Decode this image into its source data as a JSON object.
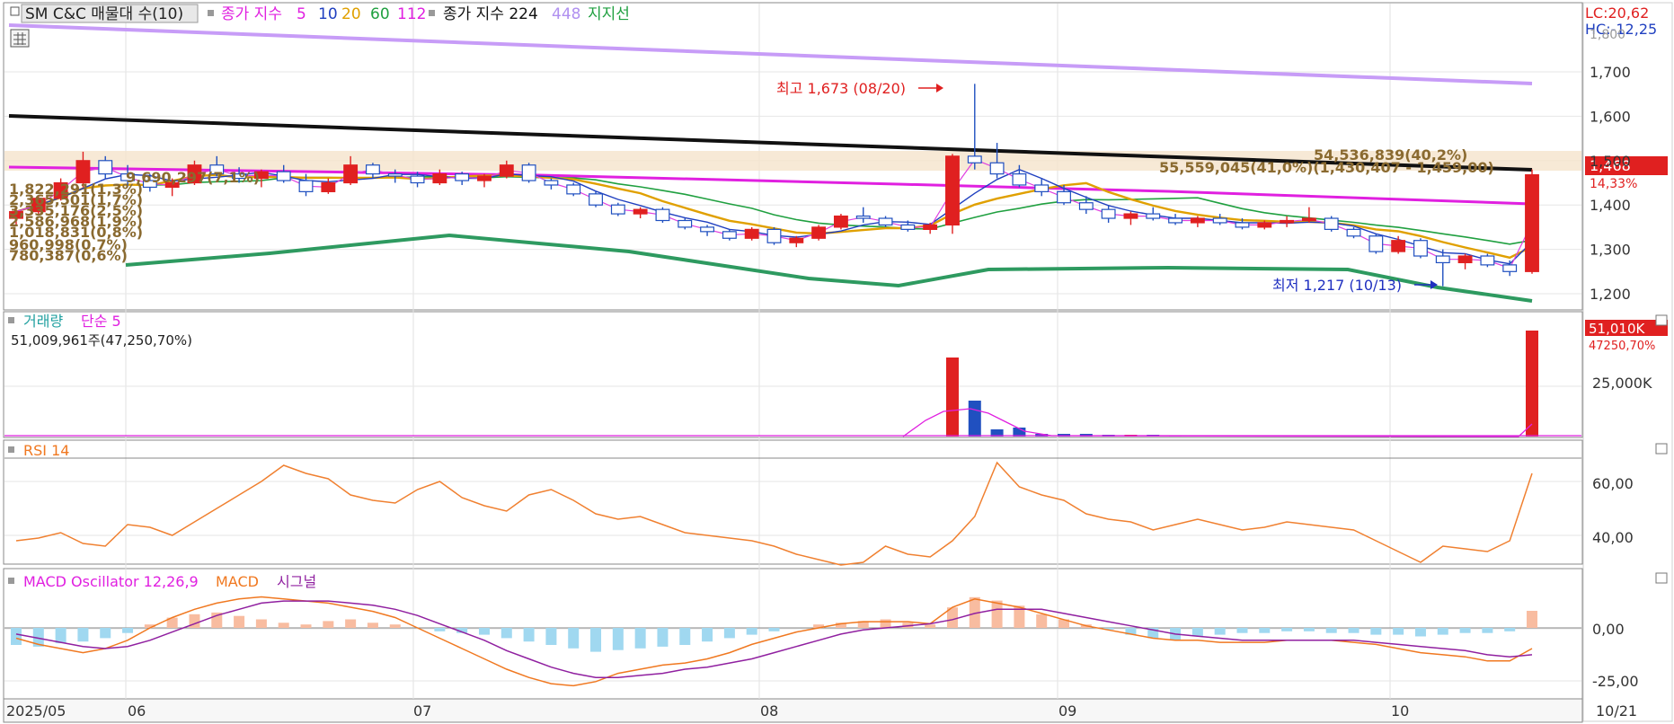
{
  "title": "SM C&C 매물대 수(10)",
  "header": {
    "ma_label": "종가 지수",
    "ma_periods": [
      "5",
      "10",
      "20",
      "60",
      "112"
    ],
    "ma_colors": [
      "#e040e0",
      "#2040c0",
      "#e0a000",
      "#20a040",
      "#e020e0"
    ],
    "ma2_label": "종가 지수 224",
    "ma2_extra": "448",
    "support_label": "지지선"
  },
  "right_info": {
    "lc": "LC:20,62",
    "hc": "HC:-12,25",
    "price": "1,468",
    "change": "14,33%"
  },
  "price_axis": {
    "ticks": [
      "1,700",
      "1,600",
      "1,500",
      "1,400",
      "1,300",
      "1,200"
    ],
    "partial_top": "1,800"
  },
  "annotations": {
    "high": "최고 1,673 (08/20)",
    "low": "최저 1,217 (10/13)"
  },
  "volume_profile": [
    "54,536,839(40,2%)",
    "55,559,045(41,0%)(1,430,407 - 1,459,00)",
    "9,690,297(7,1%)",
    "1,822,291(1,3%)",
    "2,365,501(1,7%)",
    "3,335,176(2,5%)",
    "2,586,968(1,9%)",
    "1,018,831(0,8%)",
    "960,998(0,7%)",
    "780,387(0,6%)"
  ],
  "volume_panel": {
    "title": "거래량",
    "ma_label": "단순 5",
    "info": "51,009,961주(47,250,70%)",
    "right_value": "51,010K",
    "right_sub": "47250,70%",
    "tick": "25,000K"
  },
  "rsi_panel": {
    "title": "RSI 14",
    "ticks": [
      "60,00",
      "40,00"
    ]
  },
  "macd_panel": {
    "title": "MACD Oscillator 12,26,9",
    "macd_label": "MACD",
    "signal_label": "시그널",
    "ticks": [
      "0,00",
      "-25,00"
    ]
  },
  "x_axis": {
    "labels": [
      "2025/05",
      "06",
      "07",
      "08",
      "09",
      "10",
      "10/21"
    ]
  },
  "chart_data": {
    "type": "candlestick",
    "title": "SM C&C 매물대 수(10)",
    "xlabel": "",
    "ylabel": "",
    "ylim": [
      1180,
      1820
    ],
    "period": "2025/05 - 10/21",
    "candles_sample": [
      {
        "o": 1370,
        "h": 1390,
        "l": 1355,
        "c": 1385
      },
      {
        "o": 1385,
        "h": 1420,
        "l": 1380,
        "c": 1415
      },
      {
        "o": 1415,
        "h": 1460,
        "l": 1410,
        "c": 1450
      },
      {
        "o": 1450,
        "h": 1520,
        "l": 1440,
        "c": 1500
      },
      {
        "o": 1500,
        "h": 1510,
        "l": 1460,
        "c": 1470
      },
      {
        "o": 1470,
        "h": 1490,
        "l": 1440,
        "c": 1455
      },
      {
        "o": 1455,
        "h": 1470,
        "l": 1430,
        "c": 1440
      },
      {
        "o": 1440,
        "h": 1460,
        "l": 1420,
        "c": 1450
      },
      {
        "o": 1450,
        "h": 1500,
        "l": 1445,
        "c": 1490
      },
      {
        "o": 1490,
        "h": 1510,
        "l": 1465,
        "c": 1470
      },
      {
        "o": 1470,
        "h": 1485,
        "l": 1450,
        "c": 1460
      },
      {
        "o": 1460,
        "h": 1480,
        "l": 1440,
        "c": 1475
      },
      {
        "o": 1475,
        "h": 1490,
        "l": 1450,
        "c": 1455
      },
      {
        "o": 1455,
        "h": 1470,
        "l": 1420,
        "c": 1430
      },
      {
        "o": 1430,
        "h": 1460,
        "l": 1425,
        "c": 1450
      },
      {
        "o": 1450,
        "h": 1510,
        "l": 1445,
        "c": 1490
      },
      {
        "o": 1490,
        "h": 1495,
        "l": 1460,
        "c": 1470
      },
      {
        "o": 1470,
        "h": 1480,
        "l": 1450,
        "c": 1465
      },
      {
        "o": 1465,
        "h": 1475,
        "l": 1440,
        "c": 1450
      },
      {
        "o": 1450,
        "h": 1480,
        "l": 1445,
        "c": 1470
      },
      {
        "o": 1470,
        "h": 1475,
        "l": 1445,
        "c": 1455
      },
      {
        "o": 1455,
        "h": 1470,
        "l": 1440,
        "c": 1465
      },
      {
        "o": 1465,
        "h": 1500,
        "l": 1460,
        "c": 1490
      },
      {
        "o": 1490,
        "h": 1495,
        "l": 1450,
        "c": 1455
      },
      {
        "o": 1455,
        "h": 1460,
        "l": 1435,
        "c": 1445
      },
      {
        "o": 1445,
        "h": 1450,
        "l": 1420,
        "c": 1425
      },
      {
        "o": 1425,
        "h": 1430,
        "l": 1395,
        "c": 1400
      },
      {
        "o": 1400,
        "h": 1405,
        "l": 1375,
        "c": 1380
      },
      {
        "o": 1380,
        "h": 1395,
        "l": 1370,
        "c": 1390
      },
      {
        "o": 1390,
        "h": 1395,
        "l": 1360,
        "c": 1365
      },
      {
        "o": 1365,
        "h": 1370,
        "l": 1345,
        "c": 1350
      },
      {
        "o": 1350,
        "h": 1355,
        "l": 1330,
        "c": 1340
      },
      {
        "o": 1340,
        "h": 1345,
        "l": 1320,
        "c": 1325
      },
      {
        "o": 1325,
        "h": 1350,
        "l": 1320,
        "c": 1345
      },
      {
        "o": 1345,
        "h": 1350,
        "l": 1310,
        "c": 1315
      },
      {
        "o": 1315,
        "h": 1330,
        "l": 1305,
        "c": 1325
      },
      {
        "o": 1325,
        "h": 1355,
        "l": 1320,
        "c": 1350
      },
      {
        "o": 1350,
        "h": 1380,
        "l": 1345,
        "c": 1375
      },
      {
        "o": 1375,
        "h": 1395,
        "l": 1360,
        "c": 1370
      },
      {
        "o": 1370,
        "h": 1375,
        "l": 1350,
        "c": 1355
      },
      {
        "o": 1355,
        "h": 1365,
        "l": 1340,
        "c": 1345
      },
      {
        "o": 1345,
        "h": 1360,
        "l": 1335,
        "c": 1355
      },
      {
        "o": 1355,
        "h": 1515,
        "l": 1335,
        "c": 1510
      },
      {
        "o": 1510,
        "h": 1673,
        "l": 1480,
        "c": 1495
      },
      {
        "o": 1495,
        "h": 1540,
        "l": 1460,
        "c": 1470
      },
      {
        "o": 1470,
        "h": 1490,
        "l": 1440,
        "c": 1445
      },
      {
        "o": 1445,
        "h": 1460,
        "l": 1420,
        "c": 1430
      },
      {
        "o": 1430,
        "h": 1445,
        "l": 1400,
        "c": 1405
      },
      {
        "o": 1405,
        "h": 1420,
        "l": 1380,
        "c": 1390
      },
      {
        "o": 1390,
        "h": 1400,
        "l": 1360,
        "c": 1370
      },
      {
        "o": 1370,
        "h": 1385,
        "l": 1355,
        "c": 1380
      },
      {
        "o": 1380,
        "h": 1395,
        "l": 1365,
        "c": 1370
      },
      {
        "o": 1370,
        "h": 1380,
        "l": 1355,
        "c": 1360
      },
      {
        "o": 1360,
        "h": 1375,
        "l": 1350,
        "c": 1370
      },
      {
        "o": 1370,
        "h": 1380,
        "l": 1355,
        "c": 1360
      },
      {
        "o": 1360,
        "h": 1370,
        "l": 1345,
        "c": 1350
      },
      {
        "o": 1350,
        "h": 1365,
        "l": 1345,
        "c": 1360
      },
      {
        "o": 1360,
        "h": 1375,
        "l": 1350,
        "c": 1365
      },
      {
        "o": 1365,
        "h": 1395,
        "l": 1360,
        "c": 1370
      },
      {
        "o": 1370,
        "h": 1375,
        "l": 1340,
        "c": 1345
      },
      {
        "o": 1345,
        "h": 1350,
        "l": 1325,
        "c": 1330
      },
      {
        "o": 1330,
        "h": 1335,
        "l": 1290,
        "c": 1295
      },
      {
        "o": 1295,
        "h": 1330,
        "l": 1290,
        "c": 1320
      },
      {
        "o": 1320,
        "h": 1325,
        "l": 1280,
        "c": 1285
      },
      {
        "o": 1285,
        "h": 1300,
        "l": 1217,
        "c": 1270
      },
      {
        "o": 1270,
        "h": 1290,
        "l": 1255,
        "c": 1285
      },
      {
        "o": 1285,
        "h": 1290,
        "l": 1260,
        "c": 1265
      },
      {
        "o": 1265,
        "h": 1275,
        "l": 1240,
        "c": 1250
      },
      {
        "o": 1250,
        "h": 1480,
        "l": 1245,
        "c": 1468
      }
    ],
    "high": 1673,
    "low": 1217,
    "last_close": 1468
  }
}
